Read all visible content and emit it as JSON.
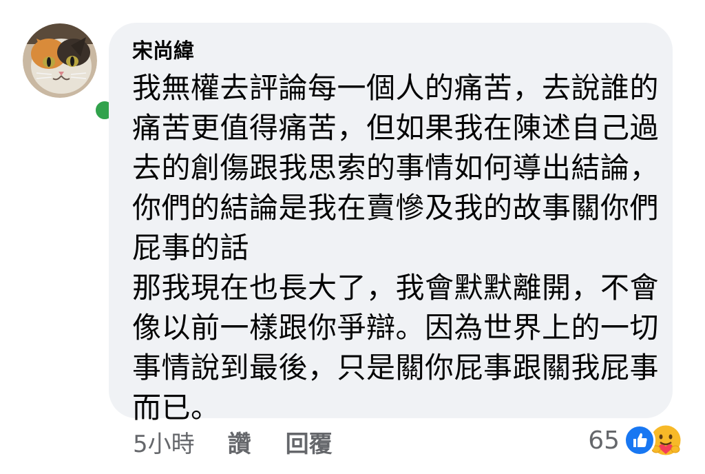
{
  "comment": {
    "author": "宋尚緯",
    "lines": [
      "我無權去評論每一個人的痛苦，去說誰的",
      "痛苦更值得痛苦，但如果我在陳述自己過",
      "去的創傷跟我思索的事情如何導出結論，",
      "你們的結論是我在賣慘及我的故事關你們",
      "屁事的話",
      "那我現在也長大了，我會默默離開，不會",
      "像以前一樣跟你爭辯。因為世界上的一切",
      "事情說到最後，只是關你屁事跟關我屁事",
      "而已。"
    ],
    "timestamp": "5小時",
    "like_label": "讚",
    "reply_label": "回覆",
    "reaction_count": "65",
    "reaction_icons": [
      "like-icon",
      "care-icon"
    ],
    "presence_status": "online"
  },
  "colors": {
    "bubble": "#f0f2f5",
    "presence": "#31a24c",
    "like": "#1877f2",
    "care": "#f7b928",
    "secondary_text": "#65676b"
  }
}
